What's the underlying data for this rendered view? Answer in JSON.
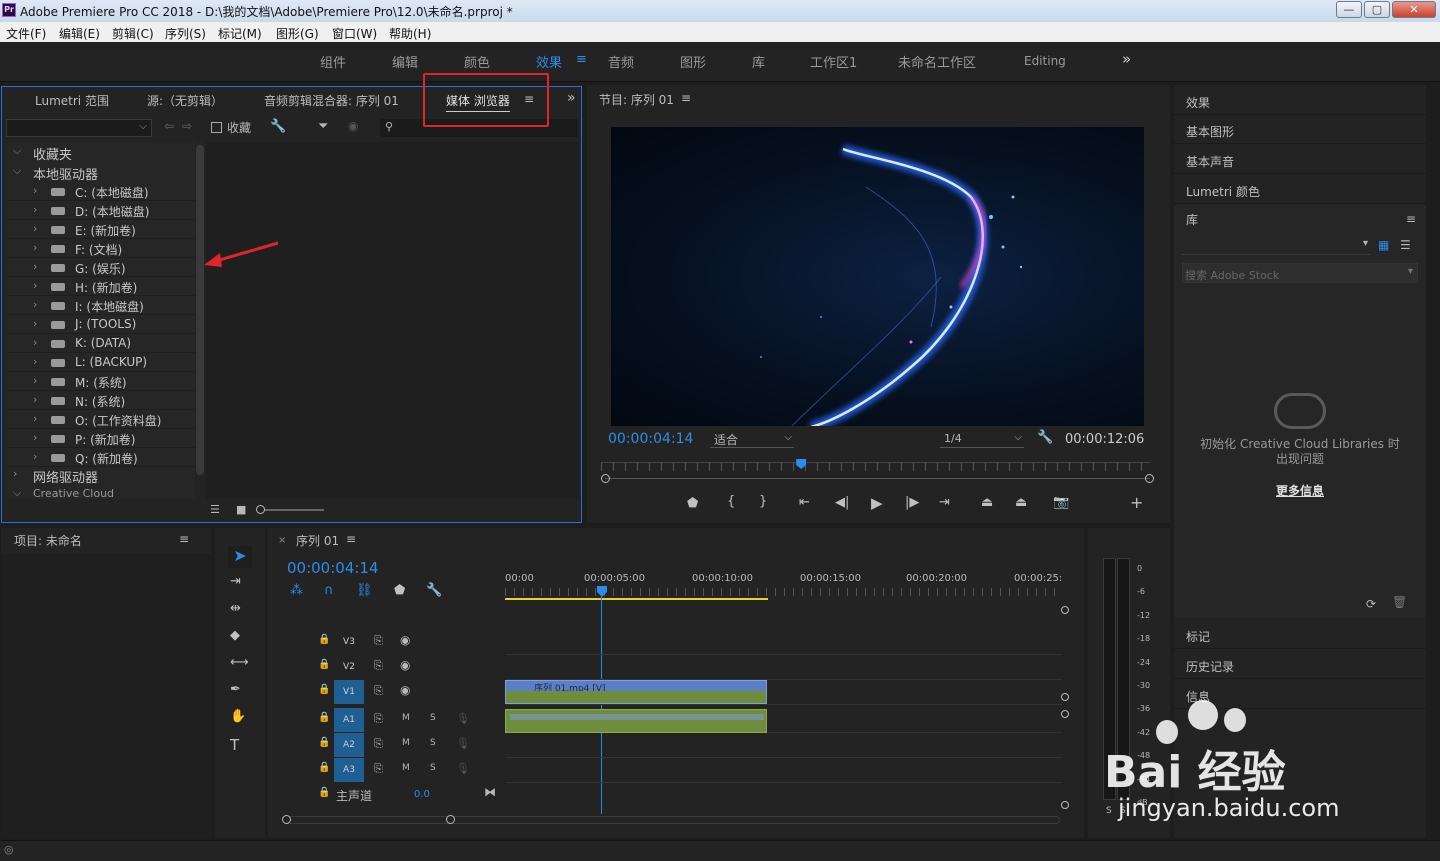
{
  "window": {
    "title": "Adobe Premiere Pro CC 2018 - D:\\我的文档\\Adobe\\Premiere Pro\\12.0\\未命名.prproj *",
    "app_badge": "Pr",
    "min": "—",
    "max": "▢",
    "close": "✕"
  },
  "menu": [
    "文件(F)",
    "编辑(E)",
    "剪辑(C)",
    "序列(S)",
    "标记(M)",
    "图形(G)",
    "窗口(W)",
    "帮助(H)"
  ],
  "workspaces": [
    "组件",
    "编辑",
    "颜色",
    "效果",
    "音频",
    "图形",
    "库",
    "工作区1",
    "未命名工作区",
    "Editing"
  ],
  "workspace_active": "效果",
  "workspace_more": "»",
  "left_panel": {
    "tabs": [
      "Lumetri 范围",
      "源:（无剪辑）",
      "音频剪辑混合器: 序列 01",
      "媒体 浏览器"
    ],
    "active_tab": "媒体 浏览器",
    "favorites_label": "收藏",
    "tree_top": [
      "收藏夹",
      "本地驱动器"
    ],
    "drives": [
      "C: (本地磁盘)",
      "D: (本地磁盘)",
      "E: (新加卷)",
      "F: (文档)",
      "G: (娱乐)",
      "H: (新加卷)",
      "I: (本地磁盘)",
      "J: (TOOLS)",
      "K: (DATA)",
      "L: (BACKUP)",
      "M: (系统)",
      "N: (系统)",
      "O: (工作资料盘)",
      "P: (新加卷)",
      "Q: (新加卷)"
    ],
    "tree_bottom": [
      "网络驱动器",
      "Creative Cloud"
    ]
  },
  "program": {
    "title": "节目: 序列 01",
    "timecode": "00:00:04:14",
    "fit": "适合",
    "quality": "1/4",
    "duration": "00:00:12:06",
    "playhead_fraction": 0.36
  },
  "right_panel": {
    "items_top": [
      "效果",
      "基本图形",
      "基本声音",
      "Lumetri 颜色"
    ],
    "library_title": "库",
    "search_placeholder": "搜索 Adobe Stock",
    "cc_message": "初始化 Creative Cloud Libraries 时出现问题",
    "cc_link": "更多信息",
    "items_bottom": [
      "标记",
      "历史记录",
      "信息"
    ]
  },
  "project": {
    "title": "项目: 未命名"
  },
  "timeline": {
    "tab": "序列 01",
    "timecode": "00:00:04:14",
    "ruler": [
      "00:00",
      "00:00:05:00",
      "00:00:10:00",
      "00:00:15:00",
      "00:00:20:00",
      "00:00:25:"
    ],
    "video_tracks": [
      "V3",
      "V2",
      "V1"
    ],
    "audio_tracks": [
      "A1",
      "A2",
      "A3"
    ],
    "master": "主声道",
    "master_value": "0.0",
    "clip_name": "序列 01.mp4 [V]",
    "mute": "M",
    "solo": "S"
  },
  "meter": {
    "scale": [
      "0",
      "-6",
      "-12",
      "-18",
      "-24",
      "-30",
      "-36",
      "-42",
      "-48",
      "-54",
      "dB"
    ],
    "channels": [
      "S",
      "S"
    ]
  },
  "watermark": {
    "text": "Bai 经验",
    "sub": "jingyan.baidu.com"
  },
  "colors": {
    "accent": "#2d8ceb",
    "highlight_box": "#e0252b",
    "panel_border": "#2d6fd0",
    "clip_video": "#5a7fc6",
    "clip_audio": "#6f8d3c",
    "work_area": "#e6d61f"
  }
}
